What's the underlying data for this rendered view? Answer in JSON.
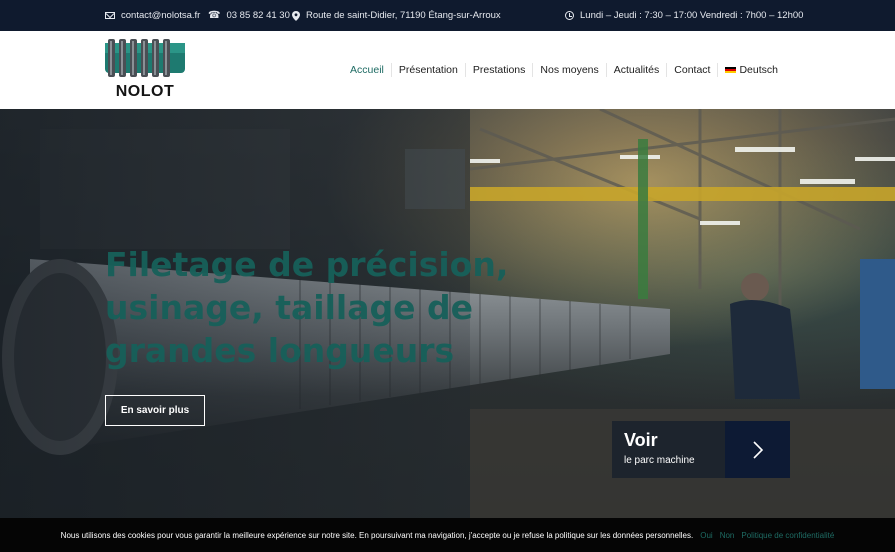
{
  "topbar": {
    "email": "contact@nolotsa.fr",
    "phone": "03 85 82 41 30",
    "address": "Route de saint-Didier, 71190 Étang-sur-Arroux",
    "hours": "Lundi – Jeudi : 7:30 – 17:00 Vendredi : 7h00 – 12h00"
  },
  "logo": {
    "text": "NOLOT"
  },
  "nav": {
    "items": [
      "Accueil",
      "Présentation",
      "Prestations",
      "Nos moyens",
      "Actualités",
      "Contact"
    ],
    "language": "Deutsch",
    "active": "Accueil"
  },
  "hero": {
    "title_lines": [
      "Filetage de précision,",
      "usinage, taillage de",
      "grandes longueurs"
    ],
    "button": "En savoir plus"
  },
  "machine_park": {
    "title": "Voir",
    "subtitle": "le parc machine"
  },
  "cookie": {
    "message": "Nous utilisons des cookies pour vous garantir la meilleure expérience sur notre site. En poursuivant ma navigation, j'accepte ou je refuse la politique sur les données personnelles.",
    "yes": "Oui",
    "no": "Non",
    "policy": "Politique de confidentialité"
  },
  "colors": {
    "topbar_bg": "#0f1a2e",
    "accent": "#1e6b63",
    "arrow_box": "#0d1a34",
    "cookie_bg": "#050505"
  },
  "icons": [
    "envelope-icon",
    "phone-icon",
    "map-pin-icon",
    "clock-icon",
    "chevron-right-icon",
    "german-flag-icon"
  ]
}
